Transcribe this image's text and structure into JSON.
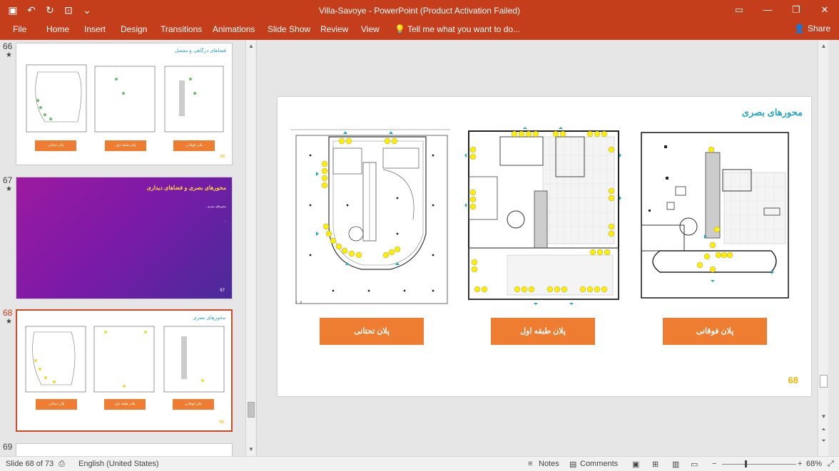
{
  "window": {
    "title": "Villa-Savoye - PowerPoint (Product Activation Failed)"
  },
  "ribbon": {
    "tabs": [
      "File",
      "Home",
      "Insert",
      "Design",
      "Transitions",
      "Animations",
      "Slide Show",
      "Review",
      "View"
    ],
    "tell_me": "Tell me what you want to do...",
    "share": "Share"
  },
  "thumbnails": [
    {
      "number": "66",
      "star": "★",
      "title": "فضاهای درگاهی و مفصل",
      "buttons": [
        "پلان تحتانی",
        "پلان طبقه اول",
        "پلان فوقانی"
      ],
      "page": "66"
    },
    {
      "number": "67",
      "star": "★",
      "title": "محورهای بصری و فضاهای دیداری",
      "lines": [
        "محورهای بصری...",
        "..."
      ],
      "page": "67"
    },
    {
      "number": "68",
      "star": "★",
      "title": "محورهای بصری",
      "buttons": [
        "پلان تحتانی",
        "پلان طبقه اول",
        "پلان فوقانی"
      ],
      "page": "68"
    },
    {
      "number": "69"
    }
  ],
  "slide": {
    "title": "محورهای بصری",
    "buttons": [
      "پلان تحتانی",
      "پلان طبقه اول",
      "پلان فوقانی"
    ],
    "page_number": "68"
  },
  "status": {
    "slide_info": "Slide 68 of 73",
    "language": "English (United States)",
    "notes": "Notes",
    "comments": "Comments",
    "zoom": "68%"
  },
  "colors": {
    "accent": "#c43e1c",
    "button_orange": "#ee7d31",
    "title_blue": "#2aa4c7",
    "page_gold": "#f2b500"
  }
}
